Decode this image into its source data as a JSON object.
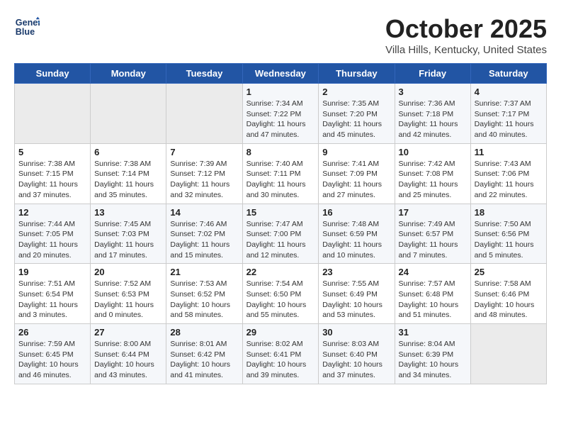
{
  "header": {
    "logo_line1": "General",
    "logo_line2": "Blue",
    "month_title": "October 2025",
    "location": "Villa Hills, Kentucky, United States"
  },
  "weekdays": [
    "Sunday",
    "Monday",
    "Tuesday",
    "Wednesday",
    "Thursday",
    "Friday",
    "Saturday"
  ],
  "weeks": [
    [
      {
        "day": "",
        "info": ""
      },
      {
        "day": "",
        "info": ""
      },
      {
        "day": "",
        "info": ""
      },
      {
        "day": "1",
        "info": "Sunrise: 7:34 AM\nSunset: 7:22 PM\nDaylight: 11 hours\nand 47 minutes."
      },
      {
        "day": "2",
        "info": "Sunrise: 7:35 AM\nSunset: 7:20 PM\nDaylight: 11 hours\nand 45 minutes."
      },
      {
        "day": "3",
        "info": "Sunrise: 7:36 AM\nSunset: 7:18 PM\nDaylight: 11 hours\nand 42 minutes."
      },
      {
        "day": "4",
        "info": "Sunrise: 7:37 AM\nSunset: 7:17 PM\nDaylight: 11 hours\nand 40 minutes."
      }
    ],
    [
      {
        "day": "5",
        "info": "Sunrise: 7:38 AM\nSunset: 7:15 PM\nDaylight: 11 hours\nand 37 minutes."
      },
      {
        "day": "6",
        "info": "Sunrise: 7:38 AM\nSunset: 7:14 PM\nDaylight: 11 hours\nand 35 minutes."
      },
      {
        "day": "7",
        "info": "Sunrise: 7:39 AM\nSunset: 7:12 PM\nDaylight: 11 hours\nand 32 minutes."
      },
      {
        "day": "8",
        "info": "Sunrise: 7:40 AM\nSunset: 7:11 PM\nDaylight: 11 hours\nand 30 minutes."
      },
      {
        "day": "9",
        "info": "Sunrise: 7:41 AM\nSunset: 7:09 PM\nDaylight: 11 hours\nand 27 minutes."
      },
      {
        "day": "10",
        "info": "Sunrise: 7:42 AM\nSunset: 7:08 PM\nDaylight: 11 hours\nand 25 minutes."
      },
      {
        "day": "11",
        "info": "Sunrise: 7:43 AM\nSunset: 7:06 PM\nDaylight: 11 hours\nand 22 minutes."
      }
    ],
    [
      {
        "day": "12",
        "info": "Sunrise: 7:44 AM\nSunset: 7:05 PM\nDaylight: 11 hours\nand 20 minutes."
      },
      {
        "day": "13",
        "info": "Sunrise: 7:45 AM\nSunset: 7:03 PM\nDaylight: 11 hours\nand 17 minutes."
      },
      {
        "day": "14",
        "info": "Sunrise: 7:46 AM\nSunset: 7:02 PM\nDaylight: 11 hours\nand 15 minutes."
      },
      {
        "day": "15",
        "info": "Sunrise: 7:47 AM\nSunset: 7:00 PM\nDaylight: 11 hours\nand 12 minutes."
      },
      {
        "day": "16",
        "info": "Sunrise: 7:48 AM\nSunset: 6:59 PM\nDaylight: 11 hours\nand 10 minutes."
      },
      {
        "day": "17",
        "info": "Sunrise: 7:49 AM\nSunset: 6:57 PM\nDaylight: 11 hours\nand 7 minutes."
      },
      {
        "day": "18",
        "info": "Sunrise: 7:50 AM\nSunset: 6:56 PM\nDaylight: 11 hours\nand 5 minutes."
      }
    ],
    [
      {
        "day": "19",
        "info": "Sunrise: 7:51 AM\nSunset: 6:54 PM\nDaylight: 11 hours\nand 3 minutes."
      },
      {
        "day": "20",
        "info": "Sunrise: 7:52 AM\nSunset: 6:53 PM\nDaylight: 11 hours\nand 0 minutes."
      },
      {
        "day": "21",
        "info": "Sunrise: 7:53 AM\nSunset: 6:52 PM\nDaylight: 10 hours\nand 58 minutes."
      },
      {
        "day": "22",
        "info": "Sunrise: 7:54 AM\nSunset: 6:50 PM\nDaylight: 10 hours\nand 55 minutes."
      },
      {
        "day": "23",
        "info": "Sunrise: 7:55 AM\nSunset: 6:49 PM\nDaylight: 10 hours\nand 53 minutes."
      },
      {
        "day": "24",
        "info": "Sunrise: 7:57 AM\nSunset: 6:48 PM\nDaylight: 10 hours\nand 51 minutes."
      },
      {
        "day": "25",
        "info": "Sunrise: 7:58 AM\nSunset: 6:46 PM\nDaylight: 10 hours\nand 48 minutes."
      }
    ],
    [
      {
        "day": "26",
        "info": "Sunrise: 7:59 AM\nSunset: 6:45 PM\nDaylight: 10 hours\nand 46 minutes."
      },
      {
        "day": "27",
        "info": "Sunrise: 8:00 AM\nSunset: 6:44 PM\nDaylight: 10 hours\nand 43 minutes."
      },
      {
        "day": "28",
        "info": "Sunrise: 8:01 AM\nSunset: 6:42 PM\nDaylight: 10 hours\nand 41 minutes."
      },
      {
        "day": "29",
        "info": "Sunrise: 8:02 AM\nSunset: 6:41 PM\nDaylight: 10 hours\nand 39 minutes."
      },
      {
        "day": "30",
        "info": "Sunrise: 8:03 AM\nSunset: 6:40 PM\nDaylight: 10 hours\nand 37 minutes."
      },
      {
        "day": "31",
        "info": "Sunrise: 8:04 AM\nSunset: 6:39 PM\nDaylight: 10 hours\nand 34 minutes."
      },
      {
        "day": "",
        "info": ""
      }
    ]
  ]
}
